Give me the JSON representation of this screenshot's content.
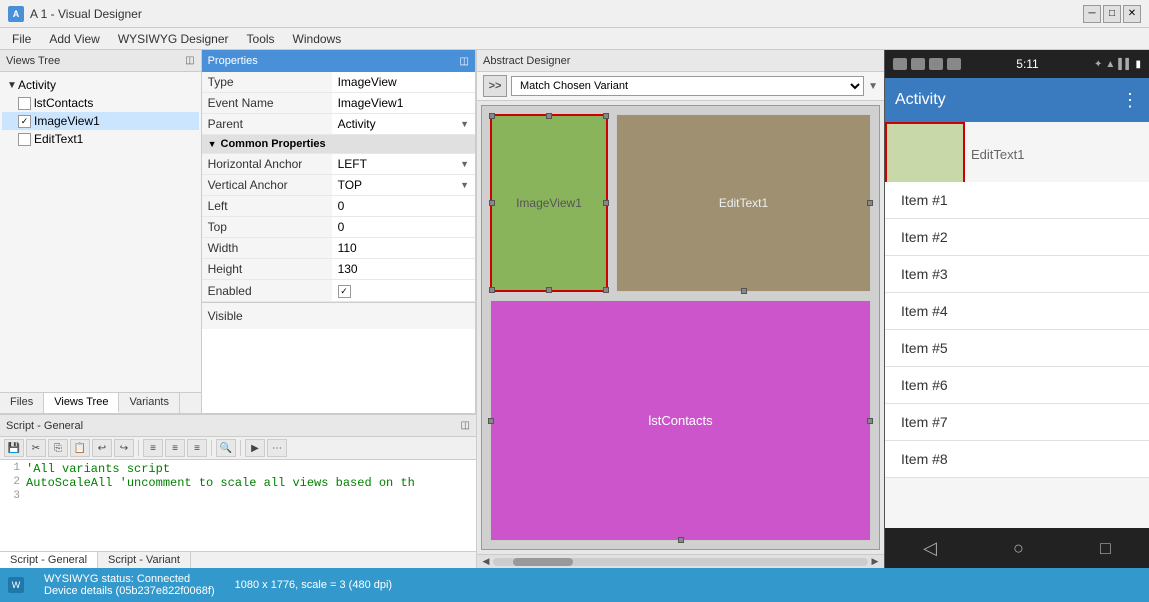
{
  "app": {
    "title": "A 1 - Visual Designer",
    "icon_label": "A"
  },
  "menu": {
    "items": [
      "File",
      "Add View",
      "WYSIWYG Designer",
      "Tools",
      "Windows"
    ]
  },
  "views_tree": {
    "panel_title": "Views Tree",
    "pin_symbol": "◫",
    "items": [
      {
        "label": "Activity",
        "level": 0,
        "expand": true,
        "checkbox": false
      },
      {
        "label": "lstContacts",
        "level": 1,
        "checkbox": true,
        "checked": false
      },
      {
        "label": "ImageView1",
        "level": 1,
        "checkbox": true,
        "checked": true
      },
      {
        "label": "EditText1",
        "level": 1,
        "checkbox": true,
        "checked": false
      }
    ],
    "tabs": [
      "Files",
      "Views Tree",
      "Variants"
    ],
    "active_tab": "Views Tree"
  },
  "properties": {
    "panel_title": "Properties",
    "pin_symbol": "◫",
    "rows": [
      {
        "label": "Type",
        "value": "ImageView"
      },
      {
        "label": "Event Name",
        "value": "ImageView1"
      },
      {
        "label": "Parent",
        "value": "Activity",
        "dropdown": true
      }
    ],
    "section_common": "Common Properties",
    "common_rows": [
      {
        "label": "Horizontal Anchor",
        "value": "LEFT",
        "dropdown": true
      },
      {
        "label": "Vertical Anchor",
        "value": "TOP",
        "dropdown": true
      },
      {
        "label": "Left",
        "value": "0"
      },
      {
        "label": "Top",
        "value": "0"
      },
      {
        "label": "Width",
        "value": "110"
      },
      {
        "label": "Height",
        "value": "130"
      },
      {
        "label": "Enabled",
        "value": "✓",
        "checkbox": true
      }
    ],
    "visible_label": "Visible"
  },
  "designer": {
    "panel_title": "Abstract Designer",
    "variant_label": "Match Chosen Variant",
    "forward_btn": ">>",
    "views": [
      {
        "id": "imageview1",
        "label": "ImageView1"
      },
      {
        "id": "edittext1",
        "label": "EditText1"
      },
      {
        "id": "lstcontacts",
        "label": "lstContacts"
      }
    ]
  },
  "script": {
    "panel_title": "Script - General",
    "pin_symbol": "◫",
    "lines": [
      {
        "num": "1",
        "code": "'All variants script",
        "type": "comment"
      },
      {
        "num": "2",
        "code": "AutoScaleAll 'uncomment to scale all views based on th",
        "type": "comment"
      },
      {
        "num": "3",
        "code": "",
        "type": "plain"
      }
    ],
    "tabs": [
      "Script - General",
      "Script - Variant"
    ],
    "active_tab": "Script - General",
    "tools": [
      "✂",
      "⎘",
      "📋",
      "↩",
      "↪",
      "🔍",
      "▶",
      "⋯"
    ]
  },
  "phone": {
    "status_time": "5:11",
    "app_title": "Activity",
    "edit_text_label": "EditText1",
    "list_items": [
      "Item #1",
      "Item #2",
      "Item #3",
      "Item #4",
      "Item #5",
      "Item #6",
      "Item #7",
      "Item #8"
    ]
  },
  "status_bar": {
    "icon_label": "W",
    "text1": "WYSIWYG status: Connected",
    "text2": "Device details (05b237e822f0068f)",
    "text3": "1080 x 1776, scale = 3 (480 dpi)"
  }
}
